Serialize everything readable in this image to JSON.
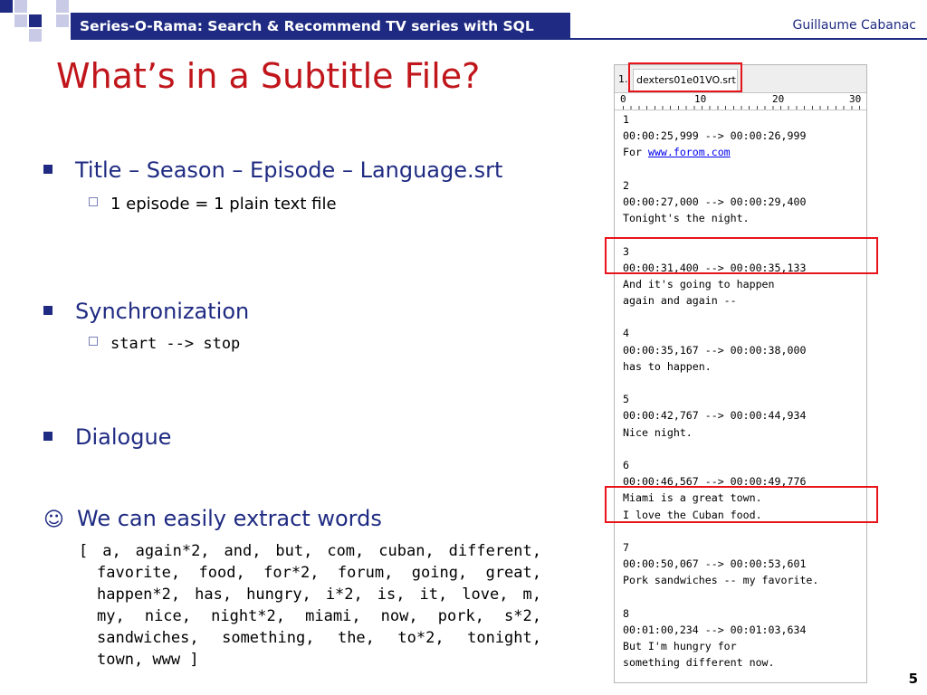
{
  "header": {
    "title": "Series-O-Rama: Search & Recommend TV series with SQL",
    "author": "Guillaume Cabanac"
  },
  "slide": {
    "title": "What’s in a Subtitle File?",
    "page_number": "5"
  },
  "bullets": {
    "b1": {
      "text": "Title – Season – Episode – Language.srt",
      "sub": "1 episode = 1 plain text file"
    },
    "b2": {
      "text": "Synchronization",
      "sub": "start --> stop"
    },
    "b3": {
      "text": "Dialogue"
    },
    "b4": {
      "icon": "smiley-icon",
      "icon_glyph": "☺",
      "text": "We can easily extract words",
      "words": "[ a, again*2, and, but, com, cuban, different, favorite, food, for*2, forum, going, great, happen*2, has, hungry, i*2, is, it, love, m, my, nice, night*2, miami, now, pork, s*2, sandwiches, something, the, to*2, tonight, town, www ]"
    }
  },
  "editor": {
    "prev_tab": "1..",
    "active_tab": "dexters01e01VO.srt",
    "ruler": [
      "0",
      "10",
      "20",
      "30"
    ],
    "lines": [
      "1",
      "00:00:25,999 --> 00:00:26,999",
      "For ",
      "",
      "2",
      "00:00:27,000 --> 00:00:29,400",
      "Tonight's the night.",
      "",
      "3",
      "00:00:31,400 --> 00:00:35,133",
      "And it's going to happen",
      "again and again --",
      "",
      "4",
      "00:00:35,167 --> 00:00:38,000",
      "has to happen.",
      "",
      "5",
      "00:00:42,767 --> 00:00:44,934",
      "Nice night.",
      "",
      "6",
      "00:00:46,567 --> 00:00:49,776",
      "Miami is a great town.",
      "I love the Cuban food.",
      "",
      "7",
      "00:00:50,067 --> 00:00:53,601",
      "Pork sandwiches -- my favorite.",
      "",
      "8",
      "00:01:00,234 --> 00:01:03,634",
      "But I'm hungry for",
      "something different now."
    ],
    "link_text": "www.forom.com"
  },
  "colors": {
    "accent_navy": "#1f2b82",
    "title_red": "#c0161b",
    "highlight_red": "#e8141b"
  }
}
